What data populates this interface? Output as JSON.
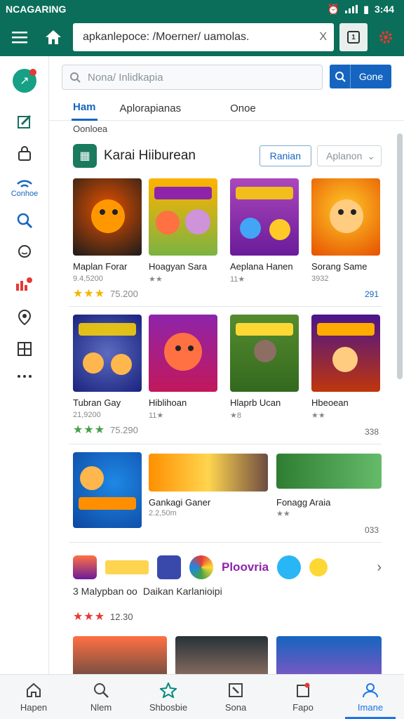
{
  "status": {
    "left": "NCAGARING",
    "time": "3:44"
  },
  "toolbar": {
    "url": "apkanlepoce: /Moerner/ uamolas.",
    "clear": "X",
    "tab_count": "1"
  },
  "rail": {
    "label_connect": "Conhoe"
  },
  "search": {
    "placeholder": "Nona/ Inlidkapia",
    "button": "Gone"
  },
  "tabs": [
    "Ham",
    "Aplorapianas",
    "Onoe"
  ],
  "caption": "Oonloea",
  "section": {
    "title": "Karai Hiiburean",
    "btn_primary": "Ranian",
    "btn_select": "Aplanon"
  },
  "cards_row1": [
    {
      "title": "Maplan Forar",
      "sub": "9.4,5200"
    },
    {
      "title": "Hoagyan Sara",
      "sub": "★★"
    },
    {
      "title": "Aeplana Hanen",
      "sub": "11★"
    },
    {
      "title": "Sorang Same",
      "sub": "3932"
    }
  ],
  "row1_rating": {
    "stars": "★★★",
    "value": "75.200",
    "count": "291"
  },
  "cards_row2": [
    {
      "title": "Tubran Gay",
      "sub": "21,9200"
    },
    {
      "title": "Hiblihoan",
      "sub": "11★"
    },
    {
      "title": "Hlaprb Ucan",
      "sub": "★8"
    },
    {
      "title": "Hbeoean",
      "sub": "★★"
    }
  ],
  "row2_rating": {
    "stars": "★★★",
    "value": "75.290",
    "count": "338"
  },
  "row3": {
    "mid_title": "Gankagi Ganer",
    "mid_sub": "2.2,50m",
    "right_title": "Fonagg Araia",
    "right_sub": "★★",
    "count": "033"
  },
  "strip": {
    "brand": "Ploovria",
    "line": "3 Malypban oo",
    "line2": "Daikan Karlanioipi"
  },
  "bottom_rating": {
    "stars": "★★★",
    "value": "12.30"
  },
  "bottomnav": [
    "Hapen",
    "Nlem",
    "Shbosbie",
    "Sona",
    "Fapo",
    "Imane"
  ],
  "colors": {
    "brand": "#0b6e5a",
    "accent": "#1565c0"
  }
}
